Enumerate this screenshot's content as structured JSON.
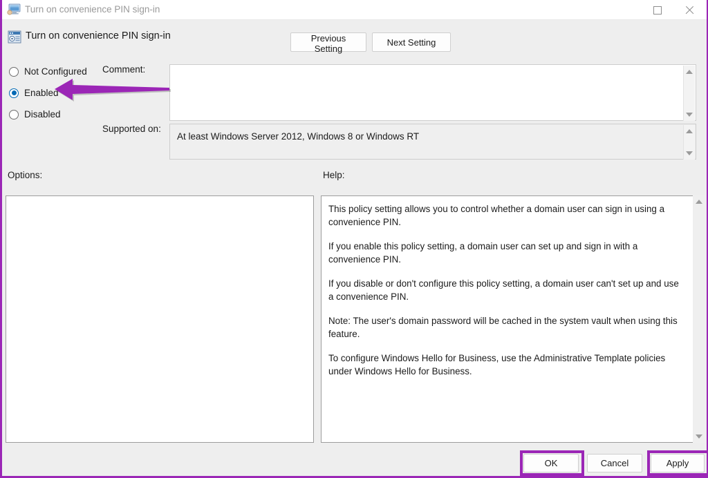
{
  "window": {
    "title": "Turn on convenience PIN sign-in",
    "title_icon": "computer-monitor-icon",
    "maximize_label": "Maximize",
    "close_label": "Close"
  },
  "header": {
    "icon": "policy-window-icon",
    "title": "Turn on convenience PIN sign-in",
    "previous_setting": "Previous Setting",
    "next_setting": "Next Setting"
  },
  "state_options": {
    "items": [
      {
        "label": "Not Configured",
        "selected": false
      },
      {
        "label": "Enabled",
        "selected": true
      },
      {
        "label": "Disabled",
        "selected": false
      }
    ]
  },
  "fields": {
    "comment_label": "Comment:",
    "comment_value": "",
    "supported_label": "Supported on:",
    "supported_value": "At least Windows Server 2012, Windows 8 or Windows RT"
  },
  "panels": {
    "options_label": "Options:",
    "options_content": "",
    "help_label": "Help:",
    "help_paragraphs": [
      "This policy setting allows you to control whether a domain user can sign in using a convenience PIN.",
      "If you enable this policy setting, a domain user can set up and sign in with a convenience PIN.",
      "If you disable or don't configure this policy setting, a domain user can't set up and use a convenience PIN.",
      "Note: The user's domain password will be cached in the system vault when using this feature.",
      "To configure Windows Hello for Business, use the Administrative Template policies under Windows Hello for Business."
    ]
  },
  "footer": {
    "ok": "OK",
    "cancel": "Cancel",
    "apply": "Apply"
  },
  "annotations": {
    "highlight_color": "#9b26b6",
    "arrow_target": "Enabled",
    "highlighted_buttons": [
      "OK",
      "Apply"
    ]
  }
}
